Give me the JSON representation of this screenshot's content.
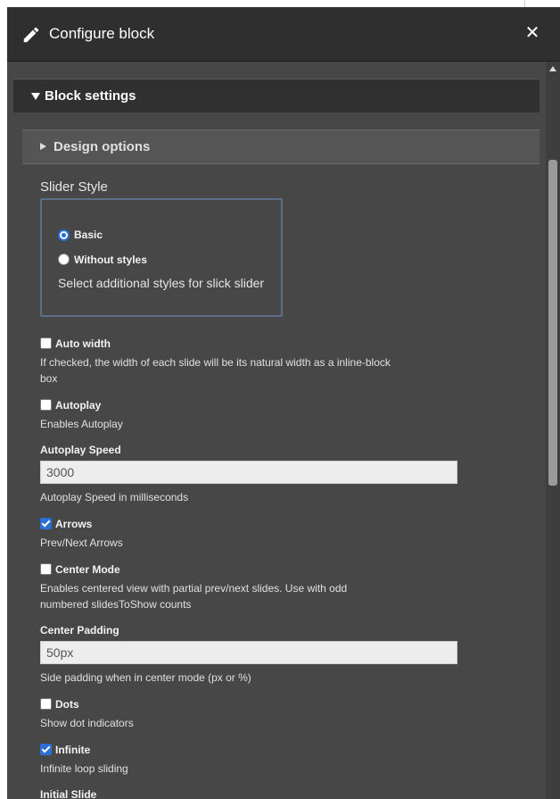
{
  "dialog": {
    "title": "Configure block",
    "close_label": "✕"
  },
  "block_settings": {
    "label": "Block settings",
    "design_options": "Design options"
  },
  "slider_style": {
    "label": "Slider Style",
    "options": [
      {
        "label": "Basic",
        "checked": true
      },
      {
        "label": "Without styles",
        "checked": false
      }
    ],
    "description": "Select additional styles for slick slider"
  },
  "fields": {
    "auto_width": {
      "label": "Auto width",
      "checked": false,
      "description_line1": "If checked, the width of each slide will be its natural width as a inline-block",
      "description_line2": "box"
    },
    "autoplay": {
      "label": "Autoplay",
      "checked": false,
      "description": "Enables Autoplay"
    },
    "autoplay_speed": {
      "label": "Autoplay Speed",
      "value": "3000",
      "description": "Autoplay Speed in milliseconds"
    },
    "arrows": {
      "label": "Arrows",
      "checked": true,
      "description": "Prev/Next Arrows"
    },
    "center_mode": {
      "label": "Center Mode",
      "checked": false,
      "description_line1": "Enables centered view with partial prev/next slides. Use with odd",
      "description_line2": "numbered slidesToShow counts"
    },
    "center_padding": {
      "label": "Center Padding",
      "value": "50px",
      "description": "Side padding when in center mode (px or %)"
    },
    "dots": {
      "label": "Dots",
      "checked": false,
      "description": "Show dot indicators"
    },
    "infinite": {
      "label": "Infinite",
      "checked": true,
      "description": "Infinite loop sliding"
    },
    "initial_slide": {
      "label": "Initial Slide"
    }
  },
  "colors": {
    "titlebar": "#2f2f2f",
    "panel": "#474747",
    "accent": "#2a6fd6"
  }
}
